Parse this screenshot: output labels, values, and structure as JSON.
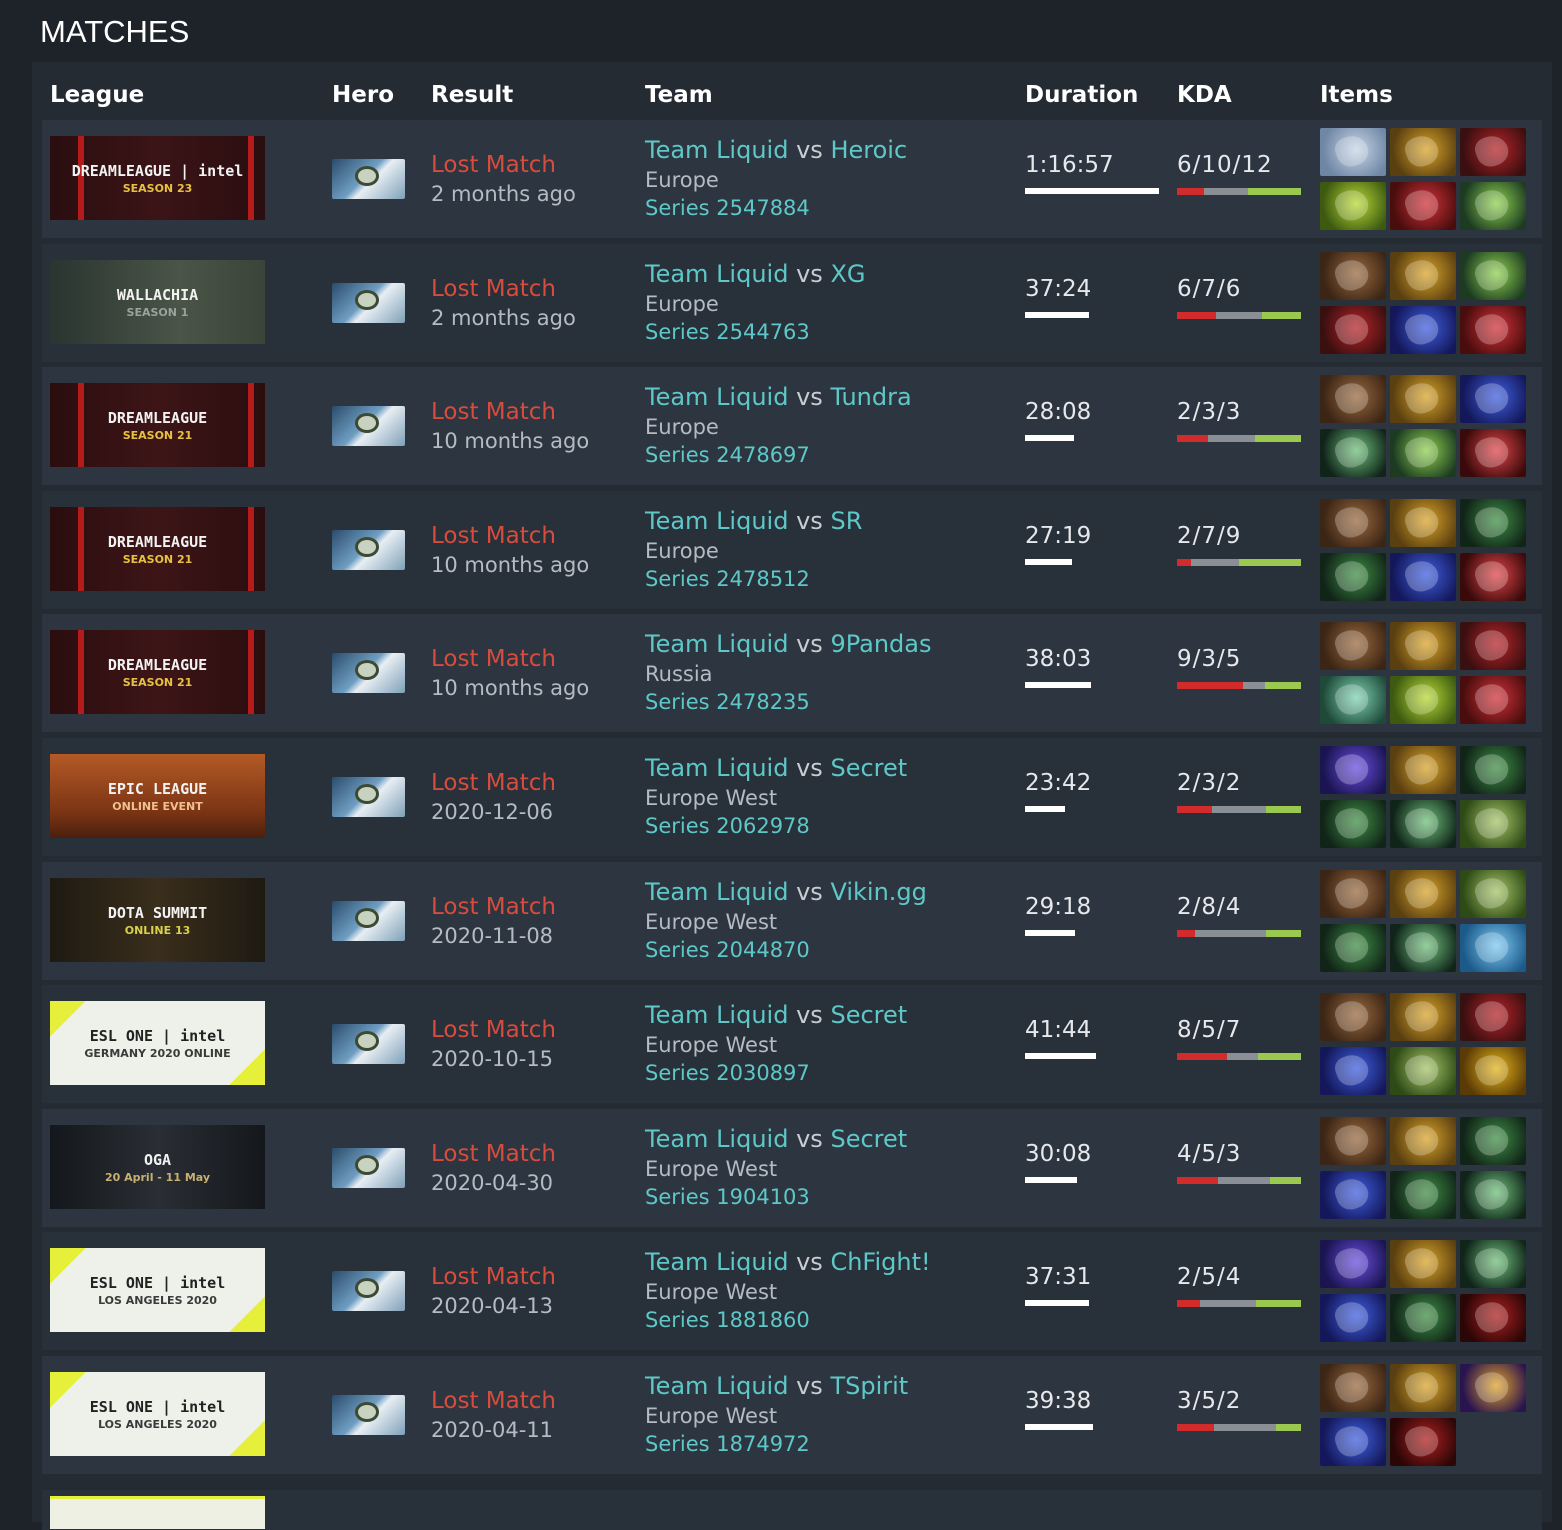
{
  "page_title": "MATCHES",
  "columns": {
    "league": "League",
    "hero": "Hero",
    "result": "Result",
    "team": "Team",
    "duration": "Duration",
    "kda": "KDA",
    "items": "Items"
  },
  "colors": {
    "loss": "#d74c3c",
    "link": "#5ec8c8",
    "kills": "#d22b2b",
    "deaths": "#8a8f95",
    "assists": "#9bc94f"
  },
  "matches": [
    {
      "league_banner": "DREAMLEAGUE | intel",
      "league_sub": "SEASON 23",
      "banner_style": "dreamleague23",
      "hero_icon": "hero-portrait",
      "result": "Lost Match",
      "when": "2 months ago",
      "team": "Team Liquid",
      "vs": "vs",
      "opponent": "Heroic",
      "region": "Europe",
      "series": "Series 2547884",
      "duration": "1:16:57",
      "duration_minutes": 77,
      "kda": "6/10/12",
      "k": 6,
      "d": 10,
      "a": 12,
      "items": [
        "mjollnir",
        "helm",
        "battle-fury",
        "blade",
        "relic",
        "sword"
      ]
    },
    {
      "league_banner": "WALLACHIA",
      "league_sub": "SEASON 1",
      "banner_style": "wallachia",
      "hero_icon": "hero-portrait",
      "result": "Lost Match",
      "when": "2 months ago",
      "team": "Team Liquid",
      "vs": "vs",
      "opponent": "XG",
      "region": "Europe",
      "series": "Series 2544763",
      "duration": "37:24",
      "duration_minutes": 37,
      "kda": "6/7/6",
      "k": 6,
      "d": 7,
      "a": 6,
      "items": [
        "boots",
        "helm",
        "sword",
        "battle-fury",
        "scepter",
        "relic"
      ]
    },
    {
      "league_banner": "DREAMLEAGUE",
      "league_sub": "SEASON 21",
      "banner_style": "dreamleague21",
      "hero_icon": "hero-portrait",
      "result": "Lost Match",
      "when": "10 months ago",
      "team": "Team Liquid",
      "vs": "vs",
      "opponent": "Tundra",
      "region": "Europe",
      "series": "Series 2478697",
      "duration": "28:08",
      "duration_minutes": 28,
      "kda": "2/3/3",
      "k": 2,
      "d": 3,
      "a": 3,
      "items": [
        "boots",
        "helm",
        "scepter",
        "wand",
        "sword",
        "crystal"
      ]
    },
    {
      "league_banner": "DREAMLEAGUE",
      "league_sub": "SEASON 21",
      "banner_style": "dreamleague21",
      "hero_icon": "hero-portrait",
      "result": "Lost Match",
      "when": "10 months ago",
      "team": "Team Liquid",
      "vs": "vs",
      "opponent": "SR",
      "region": "Europe",
      "series": "Series 2478512",
      "duration": "27:19",
      "duration_minutes": 27,
      "kda": "2/7/9",
      "k": 2,
      "d": 7,
      "a": 9,
      "items": [
        "boots",
        "helm",
        "vanguard",
        "vanguard",
        "scepter",
        "crystal"
      ]
    },
    {
      "league_banner": "DREAMLEAGUE",
      "league_sub": "SEASON 21",
      "banner_style": "dreamleague21",
      "hero_icon": "hero-portrait",
      "result": "Lost Match",
      "when": "10 months ago",
      "team": "Team Liquid",
      "vs": "vs",
      "opponent": "9Pandas",
      "region": "Russia",
      "series": "Series 2478235",
      "duration": "38:03",
      "duration_minutes": 38,
      "kda": "9/3/5",
      "k": 9,
      "d": 3,
      "a": 5,
      "items": [
        "boots",
        "helm",
        "battle-fury",
        "armor",
        "blade",
        "relic"
      ]
    },
    {
      "league_banner": "EPIC LEAGUE",
      "league_sub": "ONLINE EVENT",
      "banner_style": "epic",
      "hero_icon": "hero-portrait",
      "result": "Lost Match",
      "when": "2020-12-06",
      "team": "Team Liquid",
      "vs": "vs",
      "opponent": "Secret",
      "region": "Europe West",
      "series": "Series 2062978",
      "duration": "23:42",
      "duration_minutes": 23,
      "kda": "2/3/2",
      "k": 2,
      "d": 3,
      "a": 2,
      "items": [
        "cloak",
        "helm",
        "vanguard",
        "vanguard",
        "wand",
        "lotus"
      ]
    },
    {
      "league_banner": "DOTA SUMMIT",
      "league_sub": "ONLINE 13",
      "banner_style": "summit",
      "hero_icon": "hero-portrait",
      "result": "Lost Match",
      "when": "2020-11-08",
      "team": "Team Liquid",
      "vs": "vs",
      "opponent": "Vikin.gg",
      "region": "Europe West",
      "series": "Series 2044870",
      "duration": "29:18",
      "duration_minutes": 29,
      "kda": "2/8/4",
      "k": 2,
      "d": 8,
      "a": 4,
      "items": [
        "boots",
        "helm",
        "lotus",
        "vanguard",
        "wand",
        "orb"
      ]
    },
    {
      "league_banner": "ESL ONE | intel",
      "league_sub": "GERMANY 2020 ONLINE",
      "banner_style": "esl",
      "hero_icon": "hero-portrait",
      "result": "Lost Match",
      "when": "2020-10-15",
      "team": "Team Liquid",
      "vs": "vs",
      "opponent": "Secret",
      "region": "Europe West",
      "series": "Series 2030897",
      "duration": "41:44",
      "duration_minutes": 41,
      "kda": "8/5/7",
      "k": 8,
      "d": 5,
      "a": 7,
      "items": [
        "boots",
        "helm",
        "battle-fury",
        "scepter",
        "lotus",
        "staff"
      ]
    },
    {
      "league_banner": "OGA",
      "league_sub": "20 April - 11 May",
      "banner_style": "oga",
      "hero_icon": "hero-portrait",
      "result": "Lost Match",
      "when": "2020-04-30",
      "team": "Team Liquid",
      "vs": "vs",
      "opponent": "Secret",
      "region": "Europe West",
      "series": "Series 1904103",
      "duration": "30:08",
      "duration_minutes": 30,
      "kda": "4/5/3",
      "k": 4,
      "d": 5,
      "a": 3,
      "items": [
        "boots",
        "helm",
        "vanguard",
        "scepter",
        "vanguard",
        "wand"
      ]
    },
    {
      "league_banner": "ESL ONE | intel",
      "league_sub": "LOS ANGELES 2020",
      "banner_style": "esl",
      "hero_icon": "hero-portrait",
      "result": "Lost Match",
      "when": "2020-04-13",
      "team": "Team Liquid",
      "vs": "vs",
      "opponent": "ChFight!",
      "region": "Europe West",
      "series": "Series 1881860",
      "duration": "37:31",
      "duration_minutes": 37,
      "kda": "2/5/4",
      "k": 2,
      "d": 5,
      "a": 4,
      "items": [
        "cloak",
        "helm",
        "wand",
        "scepter",
        "vanguard",
        "blood"
      ]
    },
    {
      "league_banner": "ESL ONE | intel",
      "league_sub": "LOS ANGELES 2020",
      "banner_style": "esl",
      "hero_icon": "hero-portrait",
      "result": "Lost Match",
      "when": "2020-04-11",
      "team": "Team Liquid",
      "vs": "vs",
      "opponent": "TSpirit",
      "region": "Europe West",
      "series": "Series 1874972",
      "duration": "39:38",
      "duration_minutes": 39,
      "kda": "3/5/2",
      "k": 3,
      "d": 5,
      "a": 2,
      "items": [
        "boots",
        "helm",
        "gourd",
        "scepter",
        "blood"
      ]
    }
  ]
}
